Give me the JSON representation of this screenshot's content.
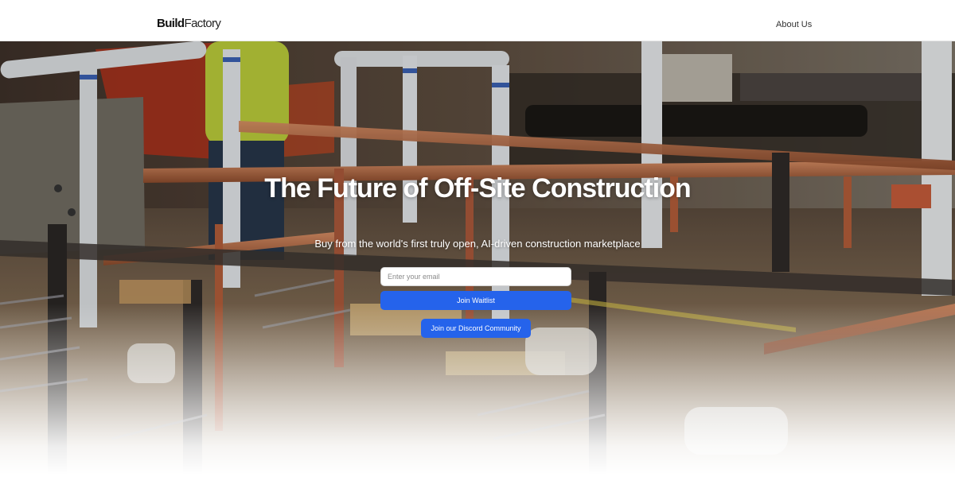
{
  "brand": {
    "logo_bold": "Build",
    "logo_light": "Factory"
  },
  "nav": {
    "about_label": "About Us"
  },
  "hero": {
    "title": "The Future of Off-Site Construction",
    "subtitle": "Buy from the world's first truly open, AI-driven construction marketplace",
    "email_placeholder": "Enter your email",
    "waitlist_button": "Join Waitlist",
    "discord_button": "Join our Discord Community"
  },
  "colors": {
    "accent": "#2563eb",
    "navbar_bg": "#ffffff",
    "text_dark": "#111111"
  },
  "icons": []
}
